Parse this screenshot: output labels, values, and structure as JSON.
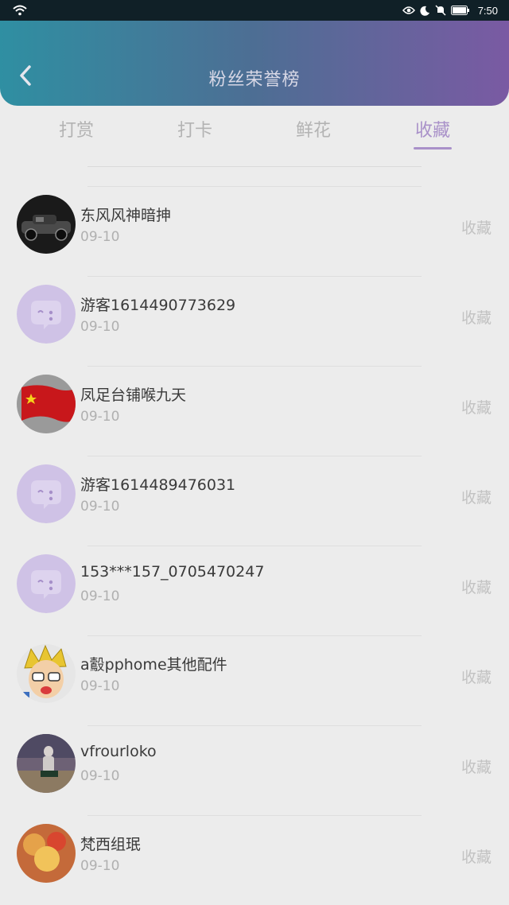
{
  "status_bar": {
    "time": "7:50"
  },
  "header": {
    "title": "粉丝荣誉榜"
  },
  "tabs": [
    {
      "label": "打赏",
      "active": false
    },
    {
      "label": "打卡",
      "active": false
    },
    {
      "label": "鲜花",
      "active": false
    },
    {
      "label": "收藏",
      "active": true
    }
  ],
  "fans": [
    {
      "name": "东风风神暗抻",
      "date": "09-10",
      "action": "收藏",
      "avatar": "car-photo-avatar"
    },
    {
      "name": "游客1614490773629",
      "date": "09-10",
      "action": "收藏",
      "avatar": "default-chat-avatar"
    },
    {
      "name": "凤足台铺喉九天",
      "date": "09-10",
      "action": "收藏",
      "avatar": "flag-avatar"
    },
    {
      "name": "游客1614489476031",
      "date": "09-10",
      "action": "收藏",
      "avatar": "default-chat-avatar"
    },
    {
      "name": "153***157_0705470247",
      "date": "09-10",
      "action": "收藏",
      "avatar": "default-chat-avatar"
    },
    {
      "name": "a鷇pphome其他配件",
      "date": "09-10",
      "action": "收藏",
      "avatar": "cartoon-avatar"
    },
    {
      "name": "vfrourloko",
      "date": "09-10",
      "action": "收藏",
      "avatar": "photo-avatar"
    },
    {
      "name": "梵西组珉",
      "date": "09-10",
      "action": "收藏",
      "avatar": "photo-avatar"
    }
  ],
  "colors": {
    "accent": "#a991c9",
    "header_start": "#2f8fa2",
    "header_end": "#7a5aa3"
  }
}
